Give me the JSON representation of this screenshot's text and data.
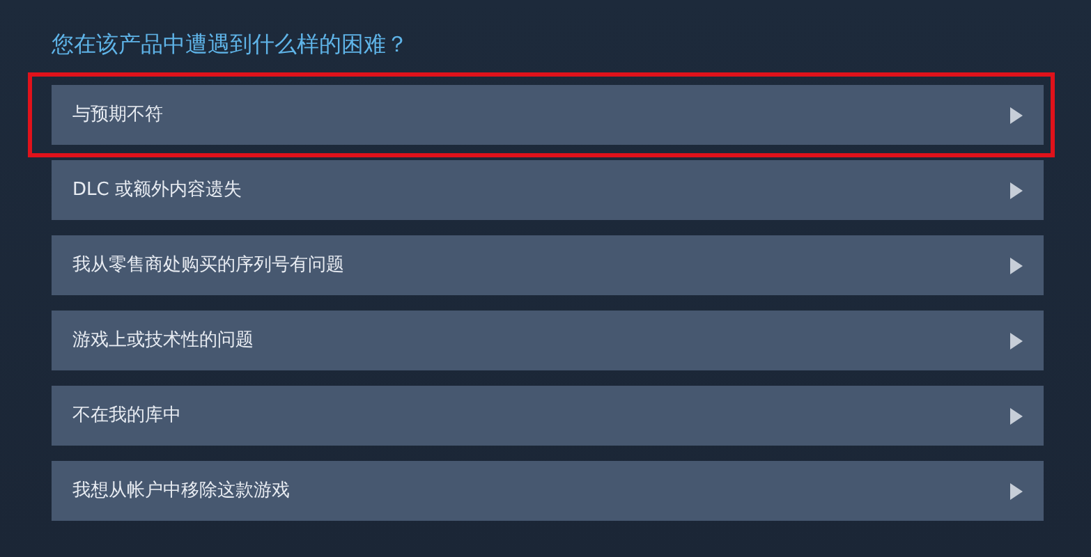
{
  "title": "您在该产品中遭遇到什么样的困难？",
  "options": [
    {
      "label": "与预期不符",
      "highlighted": true
    },
    {
      "label": "DLC 或额外内容遗失",
      "highlighted": false
    },
    {
      "label": "我从零售商处购买的序列号有问题",
      "highlighted": false
    },
    {
      "label": "游戏上或技术性的问题",
      "highlighted": false
    },
    {
      "label": "不在我的库中",
      "highlighted": false
    },
    {
      "label": "我想从帐户中移除这款游戏",
      "highlighted": false
    }
  ]
}
